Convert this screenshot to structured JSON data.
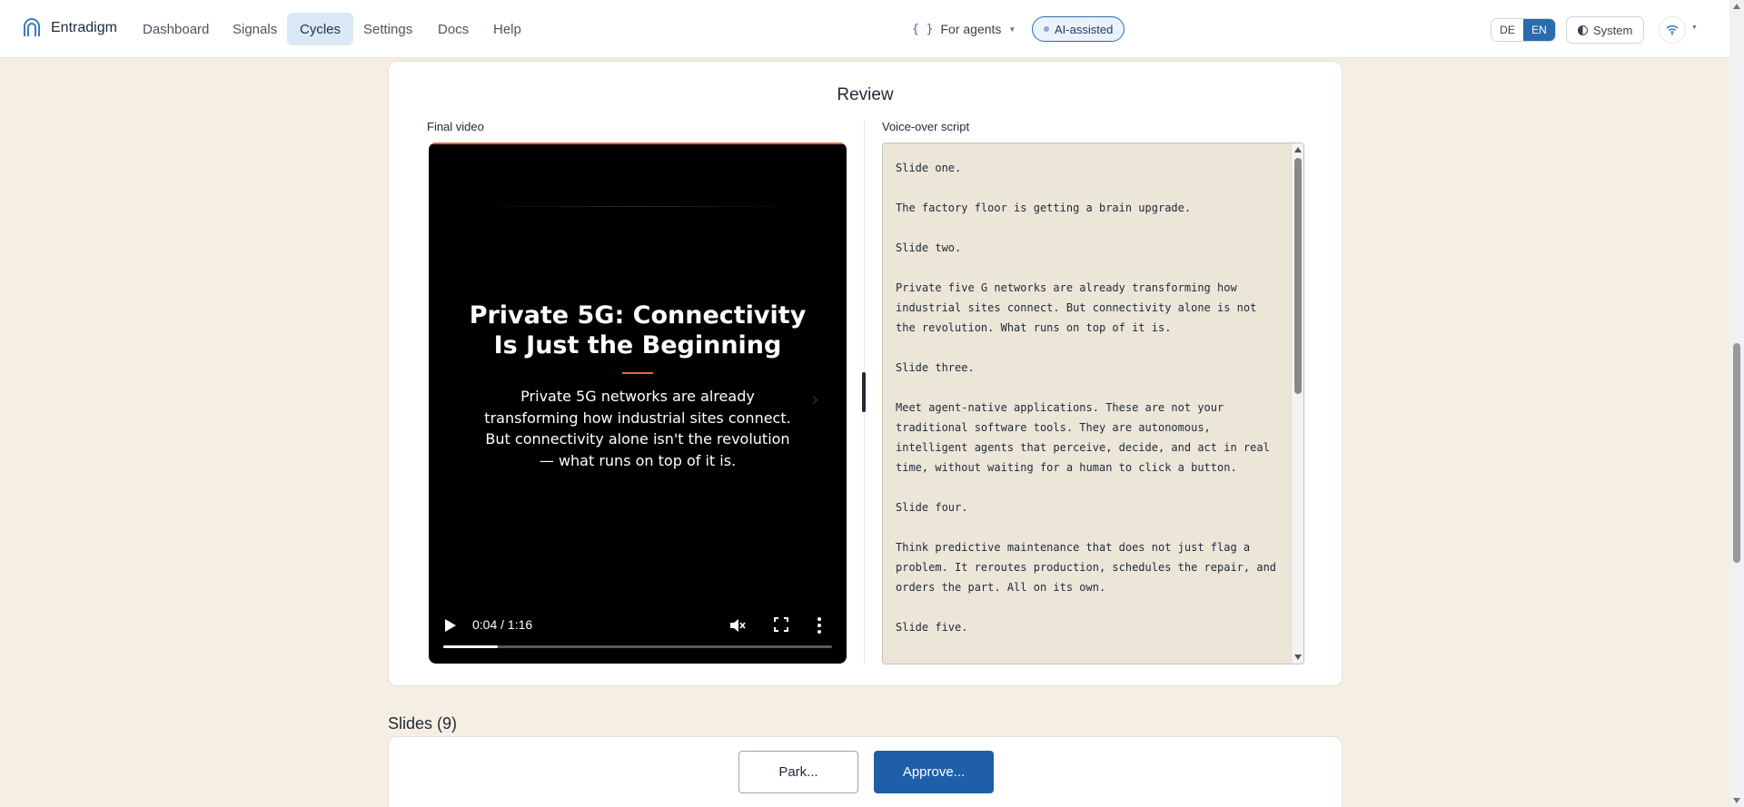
{
  "app": {
    "name": "Entradigm"
  },
  "nav": {
    "items": [
      {
        "label": "Dashboard"
      },
      {
        "label": "Signals"
      },
      {
        "label": "Cycles"
      },
      {
        "label": "Settings"
      },
      {
        "label": "Docs"
      },
      {
        "label": "Help"
      }
    ],
    "active": "Cycles",
    "agents_label": "For agents",
    "agents_braces": "{ }",
    "ai_badge": "AI-assisted",
    "lang": {
      "de": "DE",
      "en": "EN",
      "selected": "EN"
    },
    "theme_label": "System"
  },
  "review": {
    "title": "Review",
    "video_label": "Final video",
    "script_label": "Voice-over script",
    "video": {
      "title_lines": [
        "Private 5G: Connectivity",
        "Is Just the Beginning"
      ],
      "body_lines": [
        "Private 5G networks are already",
        "transforming how industrial sites connect.",
        "But connectivity alone isn't the revolution",
        "— what runs on top of it is."
      ],
      "time": "0:04 / 1:16",
      "progress": 0.14
    },
    "script_text": "Slide one.\n\nThe factory floor is getting a brain upgrade.\n\nSlide two.\n\nPrivate five G networks are already transforming how\nindustrial sites connect. But connectivity alone is not\nthe revolution. What runs on top of it is.\n\nSlide three.\n\nMeet agent-native applications. These are not your\ntraditional software tools. They are autonomous,\nintelligent agents that perceive, decide, and act in real\ntime, without waiting for a human to click a button.\n\nSlide four.\n\nThink predictive maintenance that does not just flag a\nproblem. It reroutes production, schedules the repair, and\norders the part. All on its own.\n\nSlide five."
  },
  "slides": {
    "heading": "Slides (9)"
  },
  "actions": {
    "park": "Park...",
    "approve": "Approve..."
  },
  "colors": {
    "accent": "#2b6cb0",
    "approve": "#1f5fa8",
    "video_accent": "#e2673a",
    "page_bg": "#f5efe3"
  }
}
